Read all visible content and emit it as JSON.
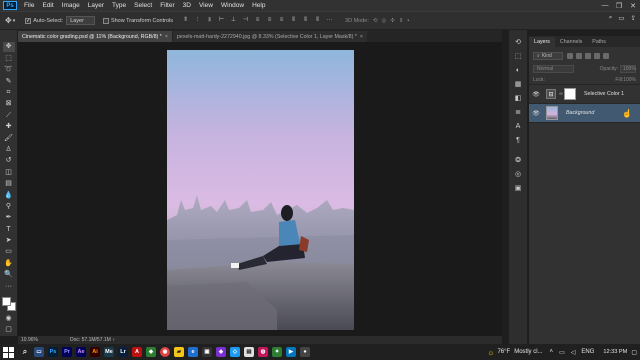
{
  "menu": [
    "File",
    "Edit",
    "Image",
    "Layer",
    "Type",
    "Select",
    "Filter",
    "3D",
    "View",
    "Window",
    "Help"
  ],
  "app_logo": "Ps",
  "window_controls": [
    "—",
    "❐",
    "✕"
  ],
  "options": {
    "auto_select_label": "Auto-Select:",
    "auto_select_target": "Layer",
    "show_transform_label": "Show Transform Controls",
    "mode_3d_label": "3D Mode:"
  },
  "tabs": [
    {
      "label": "Cinematic color grading.psd @ 11% (Background, RGB/8) *",
      "active": true
    },
    {
      "label": "pexels-matt-hardy-2272940.jpg @ 8.33% (Selective Color 1, Layer Mask/8) *",
      "active": false
    }
  ],
  "status": {
    "zoom": "10.96%",
    "doc": "Doc: 57.1M/57.1M"
  },
  "layers_panel": {
    "tabs": [
      "Layers",
      "Channels",
      "Paths"
    ],
    "filter_kind": "Kind",
    "blend_mode": "Normal",
    "opacity_label": "Opacity:",
    "opacity_value": "100%",
    "lock_label": "Lock:",
    "fill_label": "Fill:",
    "fill_value": "100%",
    "layers": [
      {
        "name": "Selective Color 1",
        "type": "adjustment",
        "selected": false
      },
      {
        "name": "Background",
        "type": "image",
        "selected": true
      }
    ]
  },
  "taskbar": {
    "weather_temp": "76°F",
    "weather_text": "Mostly cl...",
    "language": "ENG",
    "time": "12:33 PM"
  },
  "colors": {
    "accent": "#31a8ff",
    "selected_layer": "#415a72"
  }
}
